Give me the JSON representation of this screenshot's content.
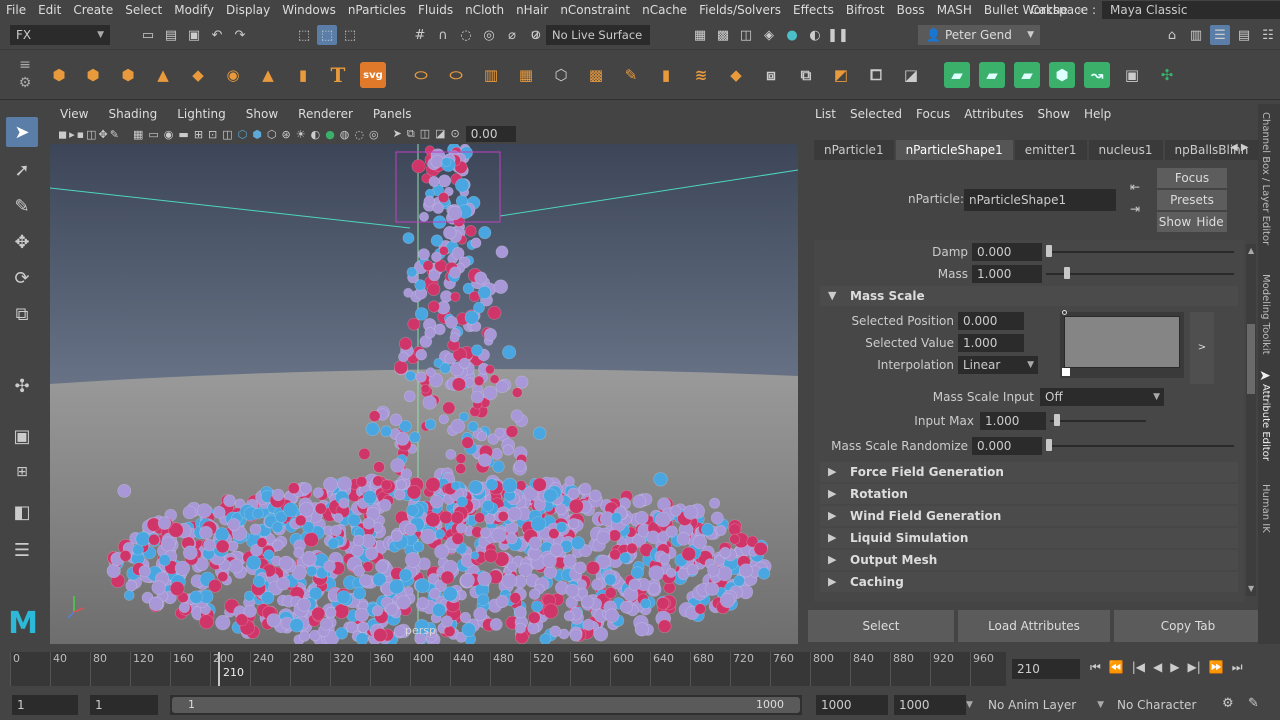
{
  "menubar": {
    "items": [
      "File",
      "Edit",
      "Create",
      "Select",
      "Modify",
      "Display",
      "Windows",
      "nParticles",
      "Fluids",
      "nCloth",
      "nHair",
      "nConstraint",
      "nCache",
      "Fields/Solvers",
      "Effects",
      "Bifrost",
      "Boss",
      "MASH",
      "Bullet",
      "Cache"
    ],
    "more_glyph": "»",
    "workspace_label": "Workspace :",
    "workspace_value": "Maya Classic"
  },
  "statusline": {
    "menuset": "FX",
    "live_surface": "No Live Surface",
    "user": "Peter Gend"
  },
  "shelf": {
    "svg_label": "svg",
    "text_label": "T"
  },
  "viewport": {
    "menu": [
      "View",
      "Shading",
      "Lighting",
      "Show",
      "Renderer",
      "Panels"
    ],
    "camera_label": "persp",
    "exposure_value": "0.00",
    "colors": {
      "particle_pink": "#d0356a",
      "particle_blue": "#4aa6e0",
      "particle_lilac": "#a898d8",
      "sky_top": "#4b5a6e",
      "ground": "#8a8a8a"
    }
  },
  "attribute_editor": {
    "menu": [
      "List",
      "Selected",
      "Focus",
      "Attributes",
      "Show",
      "Help"
    ],
    "tabs": [
      "nParticle1",
      "nParticleShape1",
      "emitter1",
      "nucleus1",
      "npBallsBlinn"
    ],
    "active_tab": "nParticleShape1",
    "node_label": "nParticle:",
    "node_value": "nParticleShape1",
    "focus_button": "Focus",
    "presets_button": "Presets",
    "show_button": "Show",
    "hide_button": "Hide",
    "damp_label": "Damp",
    "damp_value": "0.000",
    "mass_label": "Mass",
    "mass_value": "1.000",
    "mass_scale_section": "Mass Scale",
    "selected_position_label": "Selected Position",
    "selected_position_value": "0.000",
    "selected_value_label": "Selected Value",
    "selected_value_value": "1.000",
    "interpolation_label": "Interpolation",
    "interpolation_value": "Linear",
    "ramp_expand": ">",
    "mass_scale_input_label": "Mass Scale Input",
    "mass_scale_input_value": "Off",
    "input_max_label": "Input Max",
    "input_max_value": "1.000",
    "mass_scale_randomize_label": "Mass Scale Randomize",
    "mass_scale_randomize_value": "0.000",
    "collapsed_sections": [
      "Force Field Generation",
      "Rotation",
      "Wind Field Generation",
      "Liquid Simulation",
      "Output Mesh",
      "Caching"
    ],
    "bottom_buttons": [
      "Select",
      "Load Attributes",
      "Copy Tab"
    ]
  },
  "side_tabs": [
    "Channel Box / Layer Editor",
    "Modeling Toolkit",
    "Attribute Editor",
    "Human IK"
  ],
  "time_slider": {
    "ticks": [
      "0",
      "40",
      "80",
      "120",
      "160",
      "200",
      "240",
      "280",
      "320",
      "360",
      "400",
      "440",
      "480",
      "520",
      "560",
      "600",
      "640",
      "680",
      "720",
      "760",
      "800",
      "840",
      "880",
      "920",
      "960"
    ],
    "current_frame_marker": "210",
    "current_frame": "210"
  },
  "range_slider": {
    "start_field": "1",
    "playback_start": "1",
    "range_start_label": "1",
    "range_end_label": "1000",
    "playback_end": "1000",
    "end_field": "1000",
    "anim_layer": "No Anim Layer",
    "character_set": "No Character Set"
  }
}
